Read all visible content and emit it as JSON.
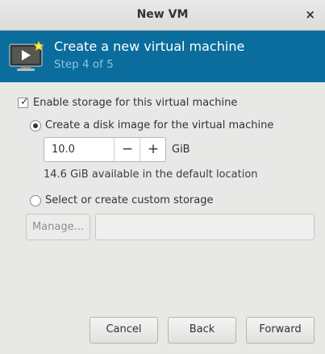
{
  "window": {
    "title": "New VM",
    "close_symbol": "×"
  },
  "banner": {
    "title": "Create a new virtual machine",
    "step": "Step 4 of 5"
  },
  "storage": {
    "enable_label": "Enable storage for this virtual machine",
    "enable_checked": true,
    "disk_image_label": "Create a disk image for the virtual machine",
    "disk_image_selected": true,
    "size_value": "10.0",
    "minus_symbol": "−",
    "plus_symbol": "+",
    "unit": "GiB",
    "available_text": "14.6 GiB available in the default location",
    "custom_label": "Select or create custom storage",
    "custom_selected": false,
    "manage_label": "Manage..."
  },
  "footer": {
    "cancel_label": "Cancel",
    "back_label": "Back",
    "forward_label": "Forward"
  },
  "colors": {
    "banner": "#0a6d9d",
    "step_text": "#8ec5e2"
  }
}
